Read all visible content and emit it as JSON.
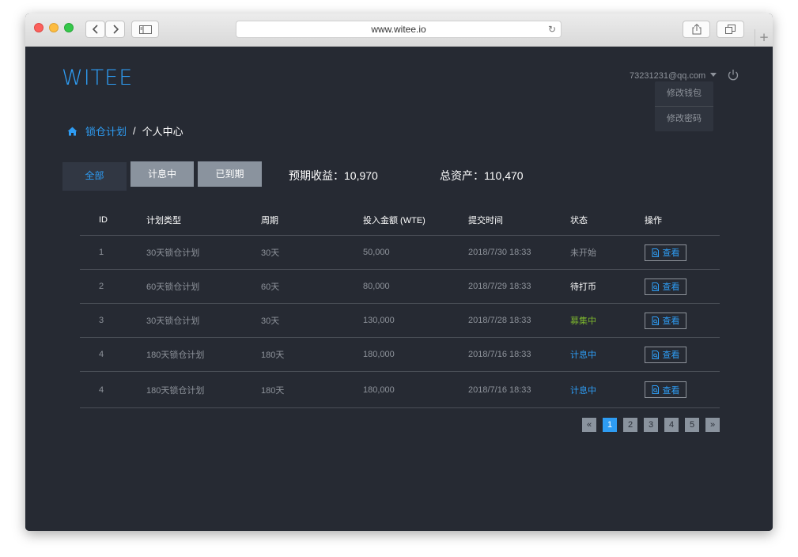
{
  "browser": {
    "url": "www.witee.io",
    "reload_icon": "↻",
    "new_tab_icon": "+"
  },
  "header": {
    "logo": "WITEE",
    "user_email": "73231231@qq.com",
    "dropdown": [
      "修改钱包",
      "修改密码"
    ]
  },
  "breadcrumb": {
    "home_icon": "home-icon",
    "link": "锁仓计划",
    "separator": "/",
    "current": "个人中心"
  },
  "filters": {
    "all": "全部",
    "interest": "计息中",
    "due": "已到期"
  },
  "stats": {
    "expected": "预期收益：10,970",
    "assets": "总资产：110,470"
  },
  "table": {
    "headers": [
      "ID",
      "计划类型",
      "周期",
      "投入金额 (WTE)",
      "提交时间",
      "状态",
      "操作"
    ],
    "rows": [
      {
        "id": "1",
        "type": "30天锁仓计划",
        "period": "30天",
        "amount": "50,000",
        "time": "2018/7/30 18:33",
        "status": "未开始",
        "action": "查看"
      },
      {
        "id": "2",
        "type": "60天锁仓计划",
        "period": "60天",
        "amount": "80,000",
        "time": "2018/7/29 18:33",
        "status": "待打币",
        "action": "查看"
      },
      {
        "id": "3",
        "type": "30天锁仓计划",
        "period": "30天",
        "amount": "130,000",
        "time": "2018/7/28 18:33",
        "status": "募集中",
        "action": "查看"
      },
      {
        "id": "4",
        "type": "180天锁仓计划",
        "period": "180天",
        "amount": "180,000",
        "time": "2018/7/16 18:33",
        "status": "计息中",
        "action": "查看"
      },
      {
        "id": "4",
        "type": "180天锁仓计划",
        "period": "180天",
        "amount": "180,000",
        "time": "2018/7/16 18:33",
        "status": "计息中",
        "action": "查看"
      }
    ]
  },
  "pagination": {
    "prev": "«",
    "pages": [
      "1",
      "2",
      "3",
      "4",
      "5"
    ],
    "next": "»",
    "current": "1"
  },
  "colors": {
    "accent": "#2e9cf3",
    "background": "#262a33",
    "status_green": "#7ab32e"
  }
}
